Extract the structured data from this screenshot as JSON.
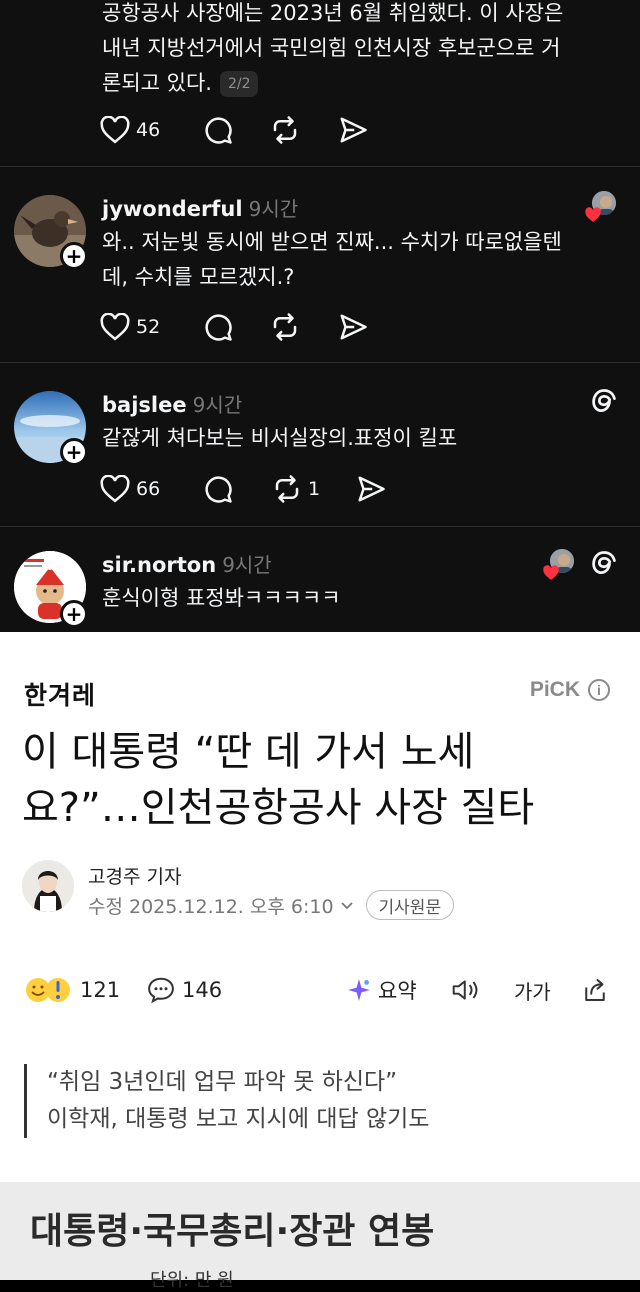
{
  "threads": {
    "post0": {
      "lines": [
        "공항공사 사장에는 2023년 6월 취임했다. 이 사장은",
        "내년 지방선거에서 국민의힘 인천시장 후보군으로 거",
        "론되고 있다."
      ],
      "page_badge": "2/2",
      "likes": "46"
    },
    "post1": {
      "username": "jywonderful",
      "time": "9시간",
      "lines": [
        "와.. 저눈빛 동시에 받으면 진짜... 수치가 따로없을텐",
        "데, 수치를 모르겠지.?"
      ],
      "likes": "52",
      "avatar_icon": "profile-photo-bird"
    },
    "post2": {
      "username": "bajslee",
      "time": "9시간",
      "lines": [
        "같잖게 쳐다보는 비서실장의.표정이 킬포"
      ],
      "likes": "66",
      "reposts": "1",
      "avatar_icon": "profile-photo-sky"
    },
    "post3": {
      "username": "sir.norton",
      "time": "9시간",
      "lines": [
        "훈식이형 표정봐ㅋㅋㅋㅋㅋ"
      ],
      "avatar_icon": "profile-photo-cartoon"
    },
    "icons": [
      "heart-icon",
      "comment-icon",
      "repost-icon",
      "share-icon",
      "threads-logo-icon",
      "plus-icon"
    ]
  },
  "article": {
    "brand": "한겨레",
    "pick_label": "PiCK",
    "headline_lines": [
      "이 대통령 “딴 데 가서 노세",
      "요?”…인천공항공사 사장 질타"
    ],
    "reporter": "고경주 기자",
    "modified": "수정 2025.12.12. 오후 6:10",
    "original_button": "기사원문",
    "reactions": "121",
    "comments": "146",
    "summary_label": "요약",
    "font_label": "가가",
    "quote_lines": [
      "“취임 3년인데 업무 파악 못 하신다”",
      "이학재, 대통령 보고 지시에 대답 않기도"
    ],
    "infobox_title": "대통령·국무총리·장관 연봉",
    "infobox_sub": "단위: 만 원"
  },
  "colors": {
    "threads_bg": "#101010",
    "threads_text": "#f3f5f7",
    "muted": "#777777",
    "like_red": "#ff3040",
    "article_bg": "#ffffff",
    "summary_star": "#7b5cff"
  }
}
